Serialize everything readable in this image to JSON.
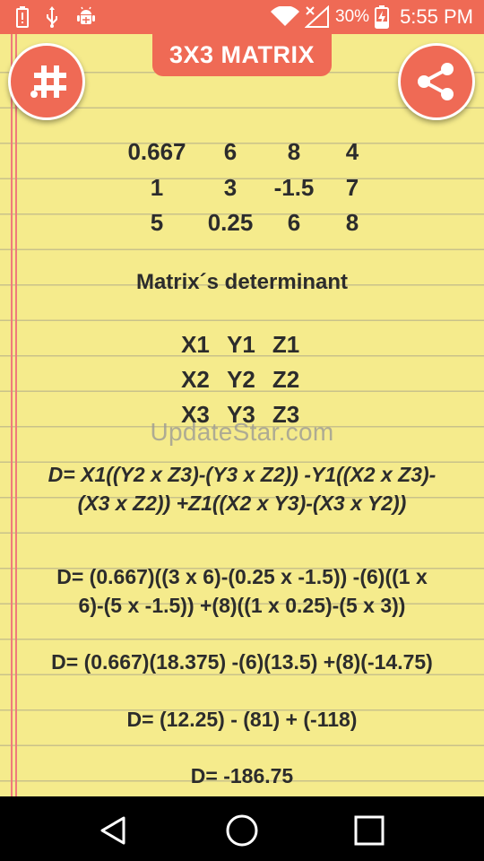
{
  "status_bar": {
    "battery_percent": "30%",
    "time": "5:55 PM",
    "left_icons": [
      "battery-alert-icon",
      "usb-icon",
      "android-debug-icon"
    ],
    "right_icons": [
      "wifi-icon",
      "signal-icon",
      "battery-charging-icon"
    ]
  },
  "header": {
    "title": "3X3 MATRIX",
    "left_button_icon": "hash-icon",
    "right_button_icon": "share-icon",
    "accent_color": "#ef6a55"
  },
  "matrix": {
    "rows": [
      [
        "0.667",
        "6",
        "8",
        "4"
      ],
      [
        "1",
        "3",
        "-1.5",
        "7"
      ],
      [
        "5",
        "0.25",
        "6",
        "8"
      ]
    ]
  },
  "determinant": {
    "heading": "Matrix´s determinant",
    "variables": [
      [
        "X1",
        "Y1",
        "Z1"
      ],
      [
        "X2",
        "Y2",
        "Z2"
      ],
      [
        "X3",
        "Y3",
        "Z3"
      ]
    ],
    "formula_line1": "D= X1((Y2 x Z3)-(Y3 x Z2)) -Y1((X2 x Z3)-",
    "formula_line2": "(X3 x Z2)) +Z1((X2 x Y3)-(X3 x Y2))",
    "substitution_line1": "D= (0.667)((3 x 6)-(0.25 x -1.5)) -(6)((1 x",
    "substitution_line2": "6)-(5 x -1.5)) +(8)((1 x 0.25)-(5 x 3))",
    "step2": "D= (0.667)(18.375) -(6)(13.5) +(8)(-14.75)",
    "step3": "D= (12.25) - (81) + (-118)",
    "result": "D= -186.75"
  },
  "watermark": "UpdateStar.com",
  "nav_bar": {
    "icons": [
      "back-icon",
      "home-icon",
      "recents-icon"
    ]
  }
}
